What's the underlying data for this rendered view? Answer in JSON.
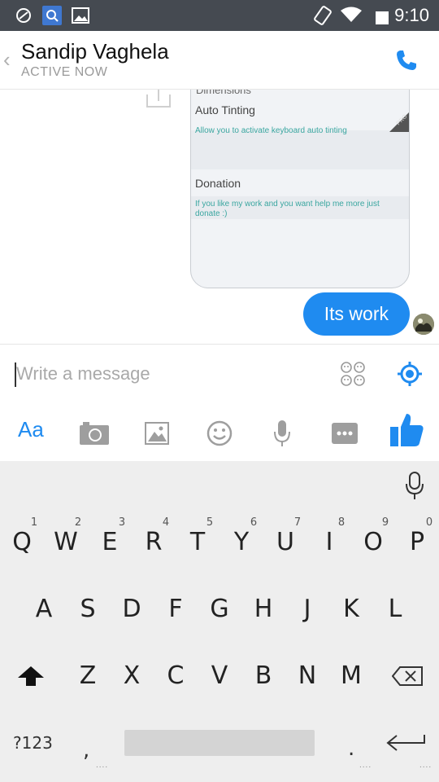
{
  "status_bar": {
    "time": "9:10",
    "icons": [
      "sync-icon",
      "search-notification-icon",
      "gallery-notification-icon",
      "rotation-icon",
      "wifi-icon",
      "battery-icon"
    ]
  },
  "header": {
    "contact_name": "Sandip Vaghela",
    "contact_status": "ACTIVE NOW",
    "back_glyph": "‹"
  },
  "chat": {
    "shared_screenshot": {
      "partial_heading": "Dimensions",
      "rows": [
        {
          "title": "Auto Tinting",
          "description": "Allow you to activate keyboard auto tinting"
        },
        {
          "title": "Donation",
          "description": "If you like my work and you want help me more just donate :)"
        }
      ],
      "badge": "PRO"
    },
    "sent_message": "Its work"
  },
  "composer": {
    "placeholder": "Write a message"
  },
  "toolbar": {
    "text_button": "Aa",
    "icons": [
      "camera-icon",
      "gallery-icon",
      "sticker-icon",
      "microphone-icon",
      "more-icon",
      "like-icon"
    ]
  },
  "keyboard": {
    "row1": [
      "Q",
      "W",
      "E",
      "R",
      "T",
      "Y",
      "U",
      "I",
      "O",
      "P"
    ],
    "row1_hints": [
      "1",
      "2",
      "3",
      "4",
      "5",
      "6",
      "7",
      "8",
      "9",
      "0"
    ],
    "row2": [
      "A",
      "S",
      "D",
      "F",
      "G",
      "H",
      "J",
      "K",
      "L"
    ],
    "row3": [
      "Z",
      "X",
      "C",
      "V",
      "B",
      "N",
      "M"
    ],
    "symbols_key": "?123",
    "comma_key": ",",
    "period_key": ".",
    "dots": "...."
  },
  "colors": {
    "accent": "#1f8bf0",
    "status_bar": "#454a51",
    "keyboard_bg": "#eeeeee",
    "link_teal": "#3aa6a0"
  }
}
